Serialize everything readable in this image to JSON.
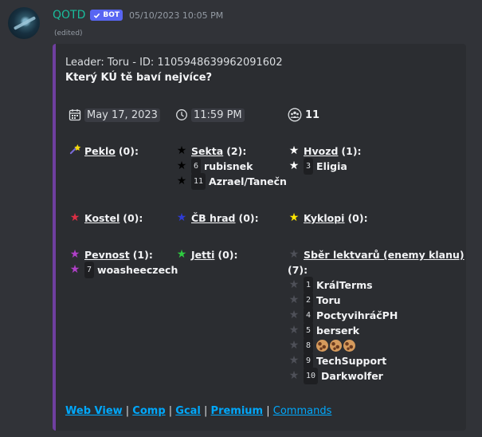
{
  "message": {
    "username": "QOTD",
    "bot_badge": "BOT",
    "timestamp": "05/10/2023 10:05 PM",
    "edited": "(edited)"
  },
  "embed": {
    "accent_color": "#6f3fa0",
    "leader_line": "Leader: Toru - ID: 1105948639962091602",
    "question": "Který KÚ tě baví nejvíce?",
    "date": "May 17, 2023",
    "time": "11:59 PM",
    "people_count": "11"
  },
  "options": {
    "peklo": {
      "name": "Peklo",
      "count": "(0):",
      "star_color": "#f5d90a"
    },
    "sekta": {
      "name": "Sekta",
      "count": "(2):",
      "star_color": "#000000",
      "members": [
        {
          "num": "6",
          "name": "rubisnek"
        },
        {
          "num": "11",
          "name": "Azrael/Tanečn"
        }
      ]
    },
    "hvozd": {
      "name": "Hvozd",
      "count": "(1):",
      "star_color": "#ffffff",
      "members": [
        {
          "num": "3",
          "name": "Eligia"
        }
      ]
    },
    "kostel": {
      "name": "Kostel",
      "count": "(0):",
      "star_color": "#dd2e44"
    },
    "cb_hrad": {
      "name": "ČB hrad",
      "count": "(0):",
      "star_color": "#2e3cd6"
    },
    "kyklopi": {
      "name": "Kyklopi",
      "count": "(0):",
      "star_color": "#ffe600"
    },
    "pevnost": {
      "name": "Pevnost",
      "count": "(1):",
      "star_color": "#b040c8",
      "members": [
        {
          "num": "7",
          "name": "woasheeczech"
        }
      ]
    },
    "jetti": {
      "name": "Jetti",
      "count": "(0):",
      "star_color": "#2ecc40"
    },
    "sber": {
      "name": "Sběr lektvarů (enemy klanu)",
      "count": "(7):",
      "star_color": "#4e5058",
      "members": [
        {
          "num": "1",
          "name": "KrálTerms"
        },
        {
          "num": "2",
          "name": "Toru"
        },
        {
          "num": "4",
          "name": "PoctyvihráčPH"
        },
        {
          "num": "5",
          "name": "berserk"
        },
        {
          "num": "8",
          "name": ""
        },
        {
          "num": "9",
          "name": "TechSupport"
        },
        {
          "num": "10",
          "name": "Darkwolfer"
        }
      ]
    }
  },
  "links": {
    "web_view": "Web View",
    "comp": "Comp",
    "gcal": "Gcal",
    "premium": "Premium",
    "commands": "Commands",
    "separator": " | "
  },
  "icons": {
    "avatar": "avatar-image",
    "calendar": "calendar-icon",
    "clock": "clock-icon",
    "people": "people-icon",
    "cookie": "cookie-emoji"
  }
}
